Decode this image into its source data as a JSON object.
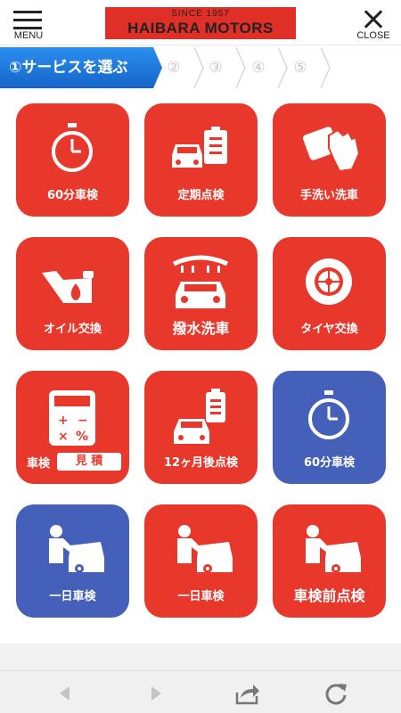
{
  "header": {
    "menu_label": "MENU",
    "close_label": "CLOSE",
    "logo_since": "SINCE  1957",
    "logo_name": "HAIBARA   MOTORS"
  },
  "steps": [
    {
      "label": "①サービスを選ぶ",
      "active": true
    },
    {
      "label": "②",
      "active": false
    },
    {
      "label": "③",
      "active": false
    },
    {
      "label": "④",
      "active": false
    },
    {
      "label": "⑤",
      "active": false
    }
  ],
  "services": [
    {
      "label": "60分車検",
      "color": "#e8382b",
      "icon": "stopwatch-icon"
    },
    {
      "label": "定期点検",
      "color": "#e8382b",
      "icon": "car-checklist-icon"
    },
    {
      "label": "手洗い洗車",
      "color": "#e8382b",
      "icon": "glove-sponge-icon"
    },
    {
      "label": "オイル交換",
      "color": "#e8382b",
      "icon": "oil-can-icon"
    },
    {
      "label": "撥水洗車",
      "color": "#e8382b",
      "icon": "car-wash-icon"
    },
    {
      "label": "タイヤ交換",
      "color": "#e8382b",
      "icon": "tire-icon"
    },
    {
      "label_a": "車検",
      "label_b": "見 積",
      "color": "#e8382b",
      "icon": "calculator-icon"
    },
    {
      "label": "12ヶ月後点検",
      "color": "#e8382b",
      "icon": "car-checklist-icon"
    },
    {
      "label": "60分車検",
      "color": "#4460b8",
      "icon": "stopwatch-icon"
    },
    {
      "label": "一日車検",
      "color": "#4460b8",
      "icon": "mechanic-icon"
    },
    {
      "label": "一日車検",
      "color": "#e8382b",
      "icon": "mechanic-icon"
    },
    {
      "label": "車検前点検",
      "color": "#e8382b",
      "icon": "mechanic-icon"
    }
  ],
  "bottom_bar": {
    "icons": [
      "back-arrow-icon",
      "forward-arrow-icon",
      "share-icon",
      "reload-icon"
    ]
  }
}
